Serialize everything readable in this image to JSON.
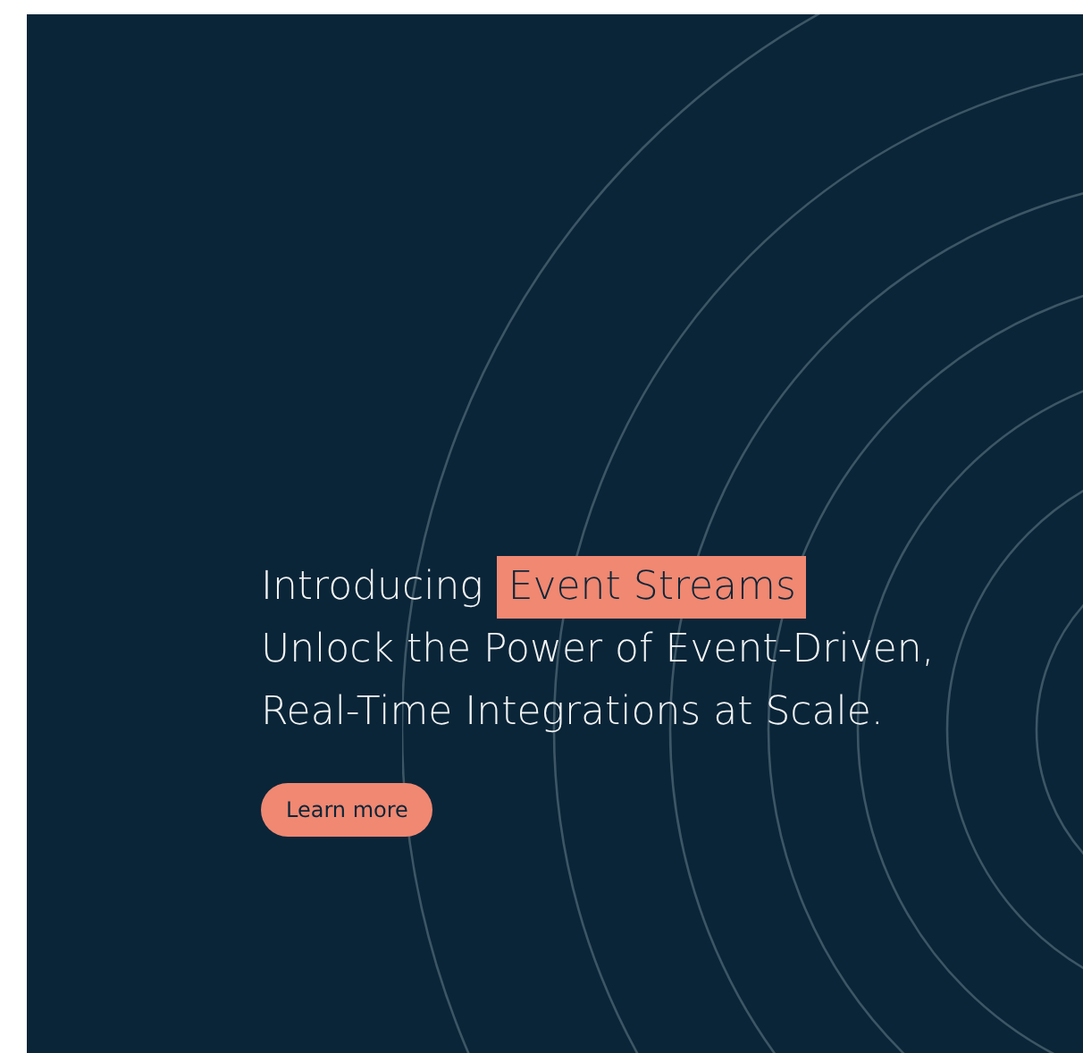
{
  "banner": {
    "intro": "Introducing",
    "highlight": "Event Streams",
    "lines": [
      "Unlock the Power of Event-Driven,",
      "Real-Time Integrations at Scale."
    ],
    "button": "Learn more"
  }
}
